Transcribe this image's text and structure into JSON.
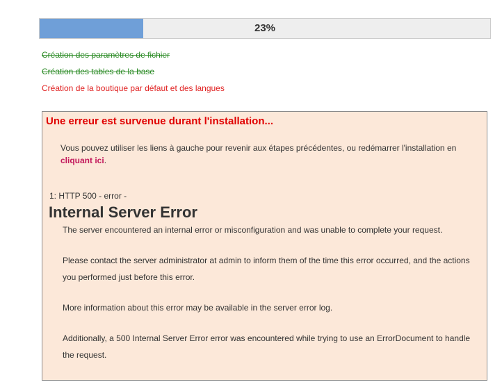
{
  "progress": {
    "percent": 23,
    "label": "23%",
    "fill_color": "#6f9fd8"
  },
  "steps": [
    {
      "label": "Création des paramètres de fichier",
      "status": "done"
    },
    {
      "label": "Création des tables de la base",
      "status": "done"
    },
    {
      "label": "Création de la boutique par défaut et des langues",
      "status": "error"
    }
  ],
  "error": {
    "title": "Une erreur est survenue durant l'installation...",
    "message_before_link": "Vous pouvez utiliser les liens à gauche pour revenir aux étapes précédentes, ou redémarrer l'installation en ",
    "link_label": "cliquant ici",
    "message_after_link": ".",
    "http_status": "1: HTTP 500 - error -",
    "server_title": "Internal Server Error",
    "server_messages": [
      "The server encountered an internal error or misconfiguration and was unable to complete your request.",
      "Please contact the server administrator at admin to inform them of the time this error occurred, and the actions you performed just before this error.",
      "More information about this error may be available in the server error log.",
      "Additionally, a 500 Internal Server Error error was encountered while trying to use an ErrorDocument to handle the request."
    ]
  },
  "colors": {
    "done": "#2a8a24",
    "error_text": "#e02222",
    "error_box_bg": "#fce8d9",
    "link": "#c2185b"
  }
}
